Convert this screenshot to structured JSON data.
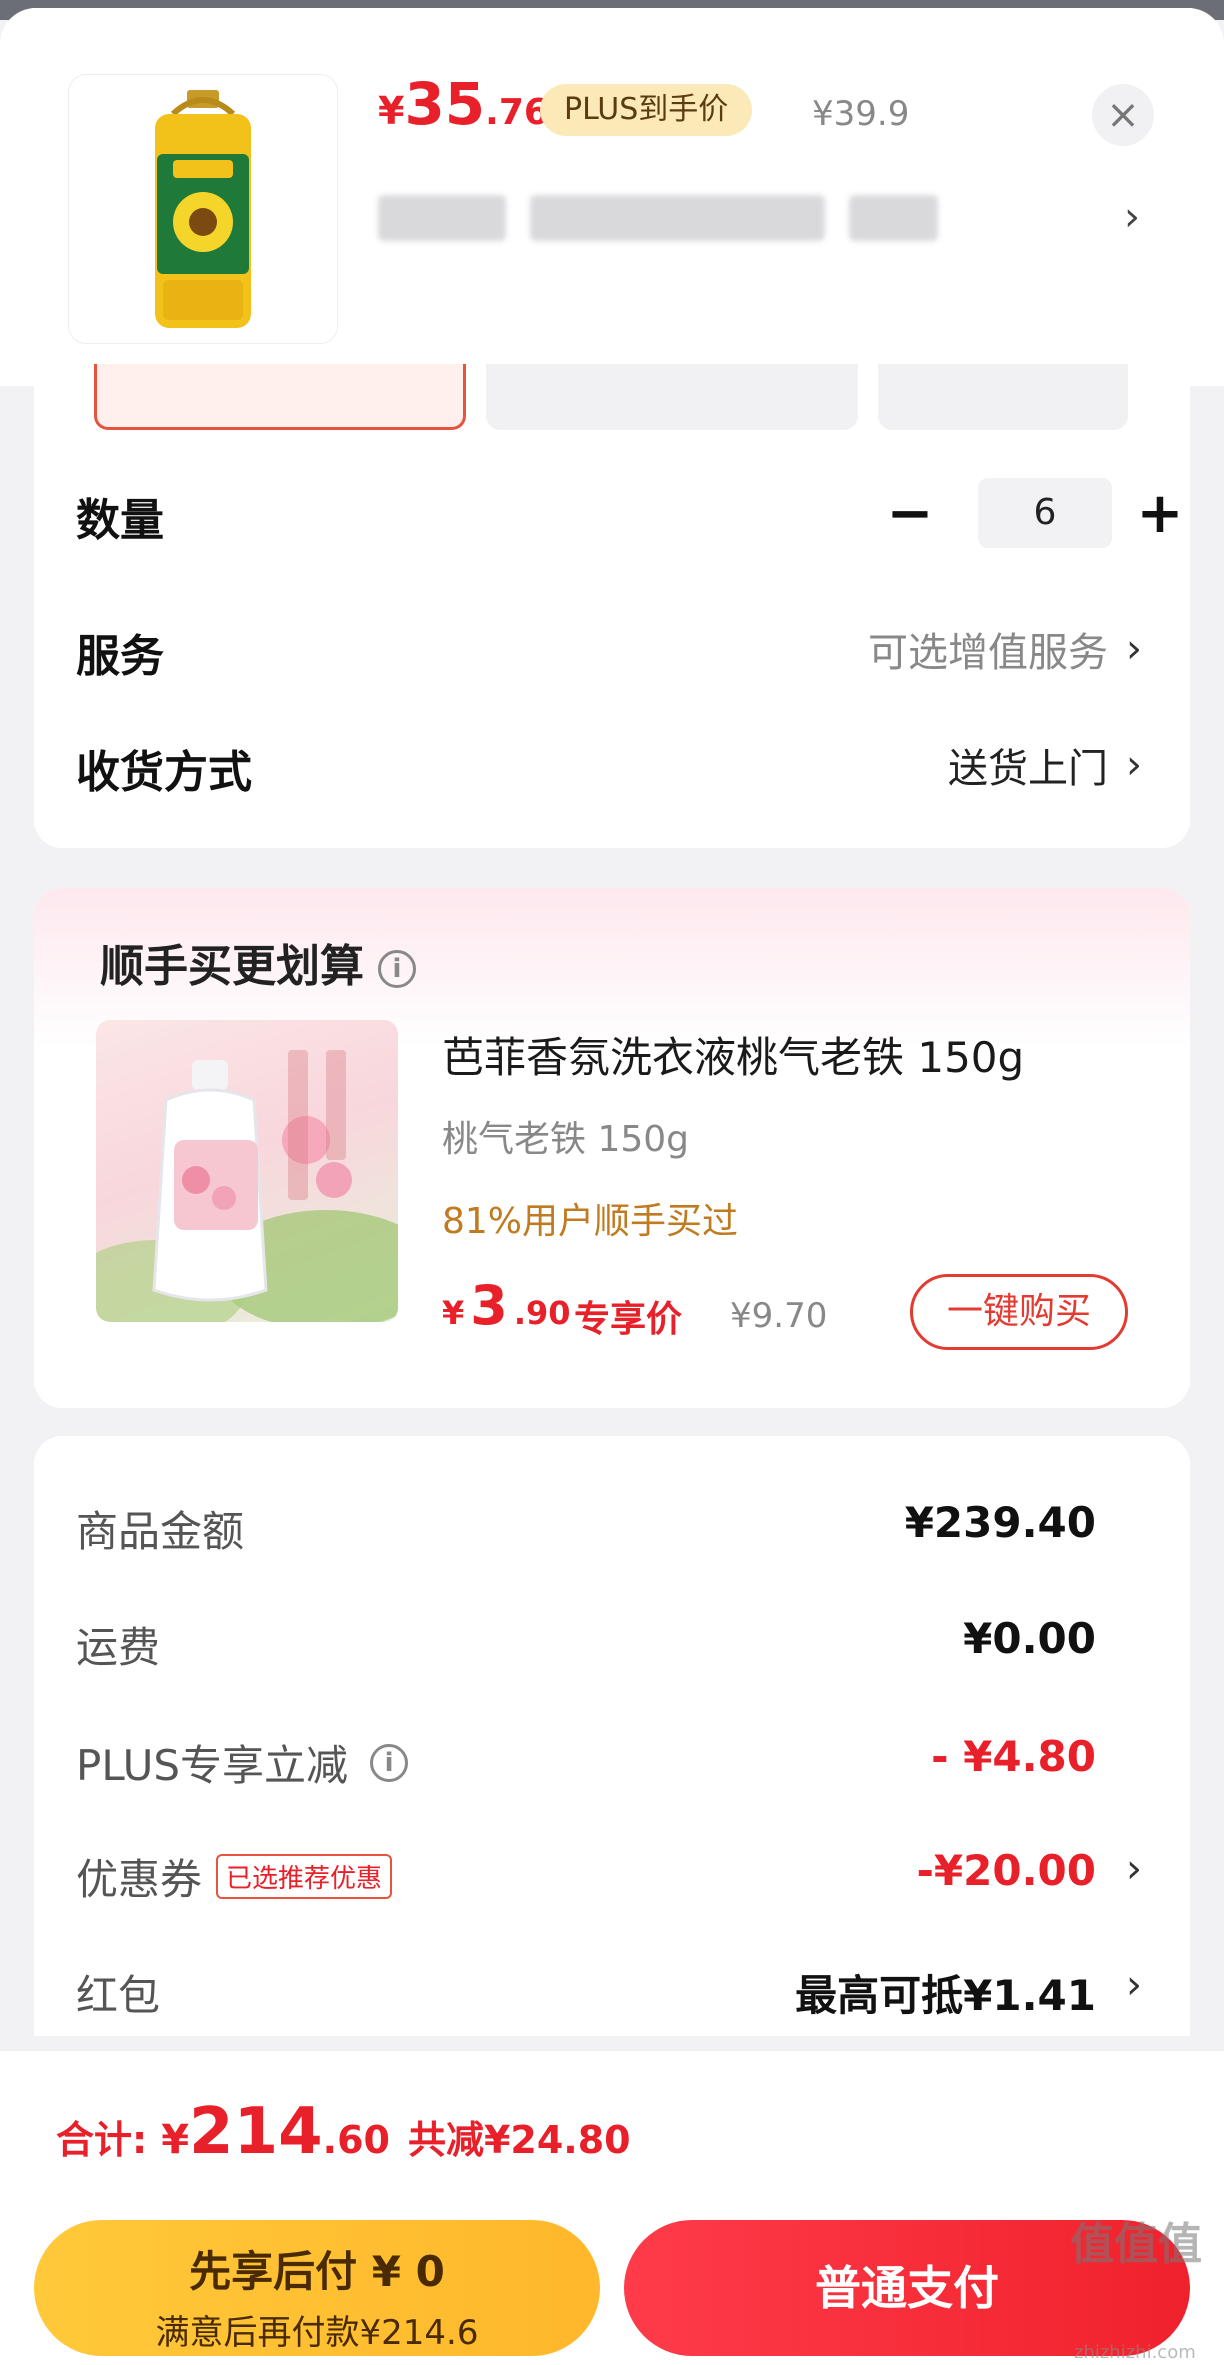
{
  "product": {
    "price_yen": "¥",
    "price_int": "35",
    "price_dec": ".76",
    "plus_badge": "PLUS到手价",
    "original_price": "¥39.9",
    "close_icon": "close-icon",
    "chevron_icon": "chevron-right-icon"
  },
  "quantity": {
    "label": "数量",
    "value": "6",
    "minus": "−",
    "plus": "+"
  },
  "service": {
    "label": "服务",
    "value": "可选增值服务"
  },
  "delivery": {
    "label": "收货方式",
    "value": "送货上门"
  },
  "addon": {
    "section_title": "顺手买更划算",
    "info_icon": "i",
    "name": "芭菲香氛洗衣液桃气老铁 150g",
    "spec": "桃气老铁 150g",
    "hint": "81%用户顺手买过",
    "price_yen": "¥",
    "price_int": "3",
    "price_dec": ".90",
    "price_tag": "专享价",
    "original_price": "¥9.70",
    "buy_label": "一键购买"
  },
  "amounts": {
    "goods_label": "商品金额",
    "goods_value": "¥239.40",
    "shipping_label": "运费",
    "shipping_value": "¥0.00",
    "plus_label": "PLUS专享立减",
    "plus_value": "- ¥4.80",
    "coupon_label": "优惠券",
    "coupon_tag": "已选推荐优惠",
    "coupon_value": "-¥20.00",
    "redpacket_label": "红包",
    "redpacket_value": "最高可抵¥1.41"
  },
  "total": {
    "label": "合计:",
    "yen": "¥",
    "int": "214",
    "dec": ".60",
    "saved": "共减¥24.80"
  },
  "buttons": {
    "later_line1": "先享后付 ¥ 0",
    "later_line2": "满意后再付款¥214.6",
    "pay": "普通支付"
  },
  "watermark": {
    "main": "值值值",
    "sub": "zhizhizhi.com"
  },
  "colors": {
    "accent_red": "#e8202a",
    "plus_gold": "#fbe9b8",
    "pay_later_yellow": "#ffc93a"
  }
}
